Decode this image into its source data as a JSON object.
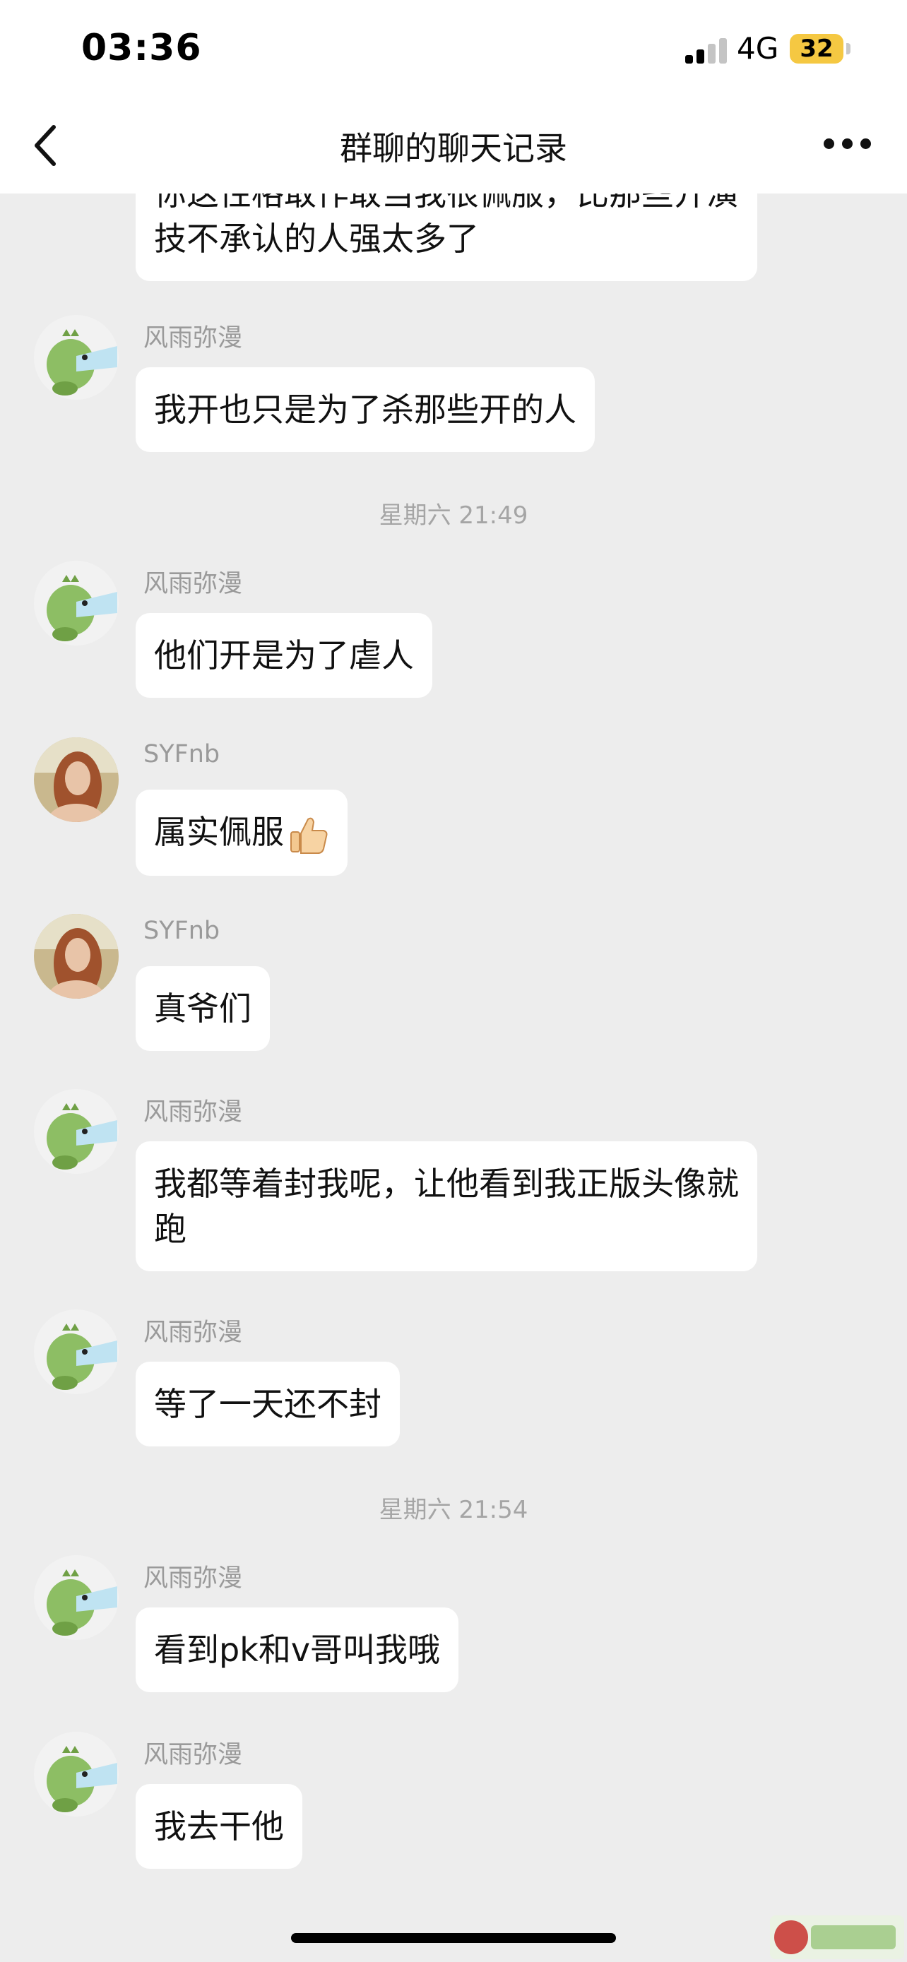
{
  "status_bar": {
    "time": "03:36",
    "network": "4G",
    "battery": "32"
  },
  "nav": {
    "title": "群聊的聊天记录"
  },
  "icons": {
    "back": "chevron-left-icon",
    "more": "more-horizontal-icon",
    "signal": "signal-bars-icon",
    "thumbs_up": "thumbs-up-emoji"
  },
  "colors": {
    "background": "#EDEDED",
    "bubble": "#FFFFFF",
    "battery": "#F5C842",
    "meta_text": "#9A9A9A"
  },
  "messages": [
    {
      "type": "message",
      "sender": "",
      "text": "你这性格敢作敢当我很佩服，比那些开演技不承认的人强太多了"
    },
    {
      "type": "message",
      "sender": "风雨弥漫",
      "text": "我开也只是为了杀那些开的人"
    },
    {
      "type": "timestamp",
      "text": "星期六 21:49"
    },
    {
      "type": "message",
      "sender": "风雨弥漫",
      "text": "他们开是为了虐人"
    },
    {
      "type": "message",
      "sender": "SYFnb",
      "text": "属实佩服"
    },
    {
      "type": "message",
      "sender": "SYFnb",
      "text": "真爷们"
    },
    {
      "type": "message",
      "sender": "风雨弥漫",
      "text": "我都等着封我呢，让他看到我正版头像就跑"
    },
    {
      "type": "message",
      "sender": "风雨弥漫",
      "text": "等了一天还不封"
    },
    {
      "type": "timestamp",
      "text": "星期六 21:54"
    },
    {
      "type": "message",
      "sender": "风雨弥漫",
      "text": "看到pk和v哥叫我哦"
    },
    {
      "type": "message",
      "sender": "风雨弥漫",
      "text": "我去干他"
    }
  ]
}
